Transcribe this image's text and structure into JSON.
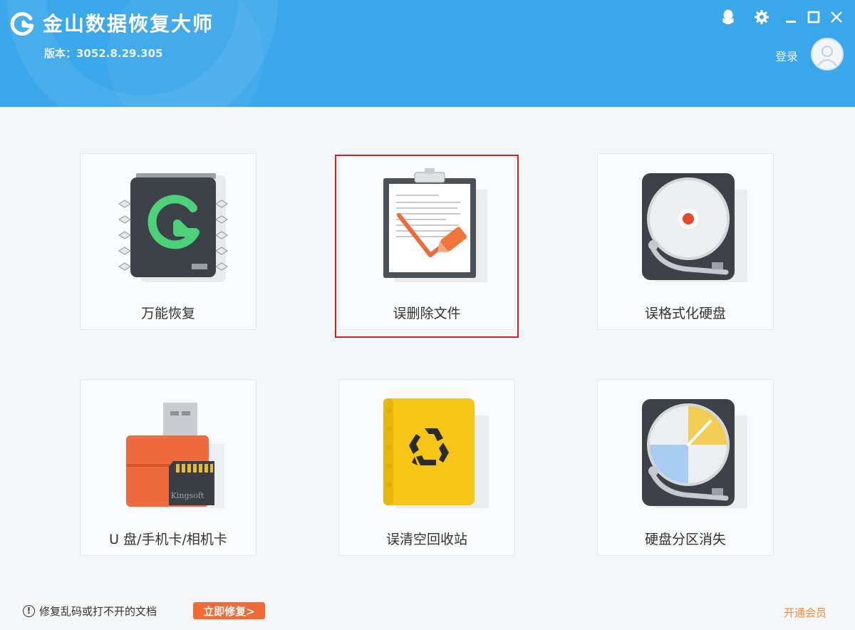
{
  "app": {
    "title": "金山数据恢复大师",
    "version": "版本：3052.8.29.305"
  },
  "header": {
    "login_label": "登录",
    "controls": [
      "qq-icon",
      "gear-icon",
      "minimize-icon",
      "maximize-icon",
      "close-icon"
    ]
  },
  "cards": [
    {
      "label": "万能恢复",
      "icon": "chip-icon"
    },
    {
      "label": "误删除文件",
      "icon": "clipboard-check-icon",
      "highlighted": true
    },
    {
      "label": "误格式化硬盘",
      "icon": "hard-disk-icon"
    },
    {
      "label": "U 盘/手机卡/相机卡",
      "icon": "usb-sdcard-icon"
    },
    {
      "label": "误清空回收站",
      "icon": "recycle-bin-icon"
    },
    {
      "label": "硬盘分区消失",
      "icon": "disk-partition-icon"
    }
  ],
  "footer": {
    "tip": "修复乱码或打不开的文档",
    "repair_button": "立即修复>",
    "vip_link": "开通会员"
  },
  "colors": {
    "header_bg": "#3aa7ea",
    "highlight_border": "#d21f2a",
    "repair_button_bg": "#f26a35",
    "vip_link": "#f08a3c"
  },
  "icon_text": {
    "sd_brand": "Kingsoft"
  }
}
